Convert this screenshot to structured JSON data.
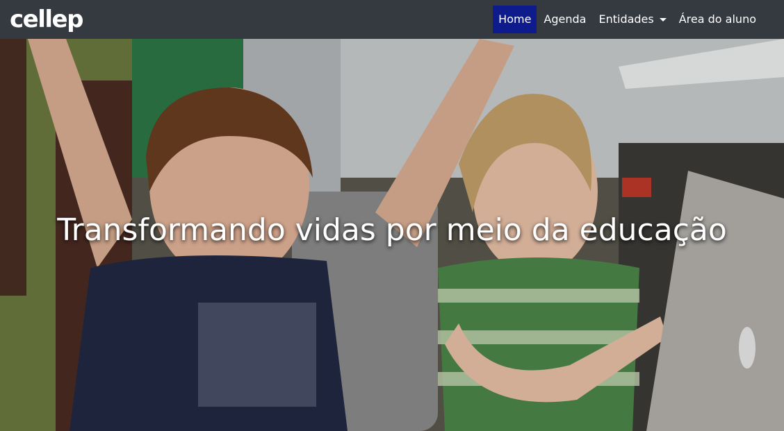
{
  "navbar": {
    "brand": "cellep",
    "items": [
      {
        "label": "Home",
        "active": true
      },
      {
        "label": "Agenda"
      },
      {
        "label": "Entidades"
      },
      {
        "label": "Área do aluno"
      }
    ]
  },
  "hero": {
    "headline": "Transformando vidas por meio da educação"
  },
  "colors": {
    "navbar_bg": "#343a40",
    "active_nav_bg": "#0d1b8c",
    "text": "#ffffff"
  }
}
